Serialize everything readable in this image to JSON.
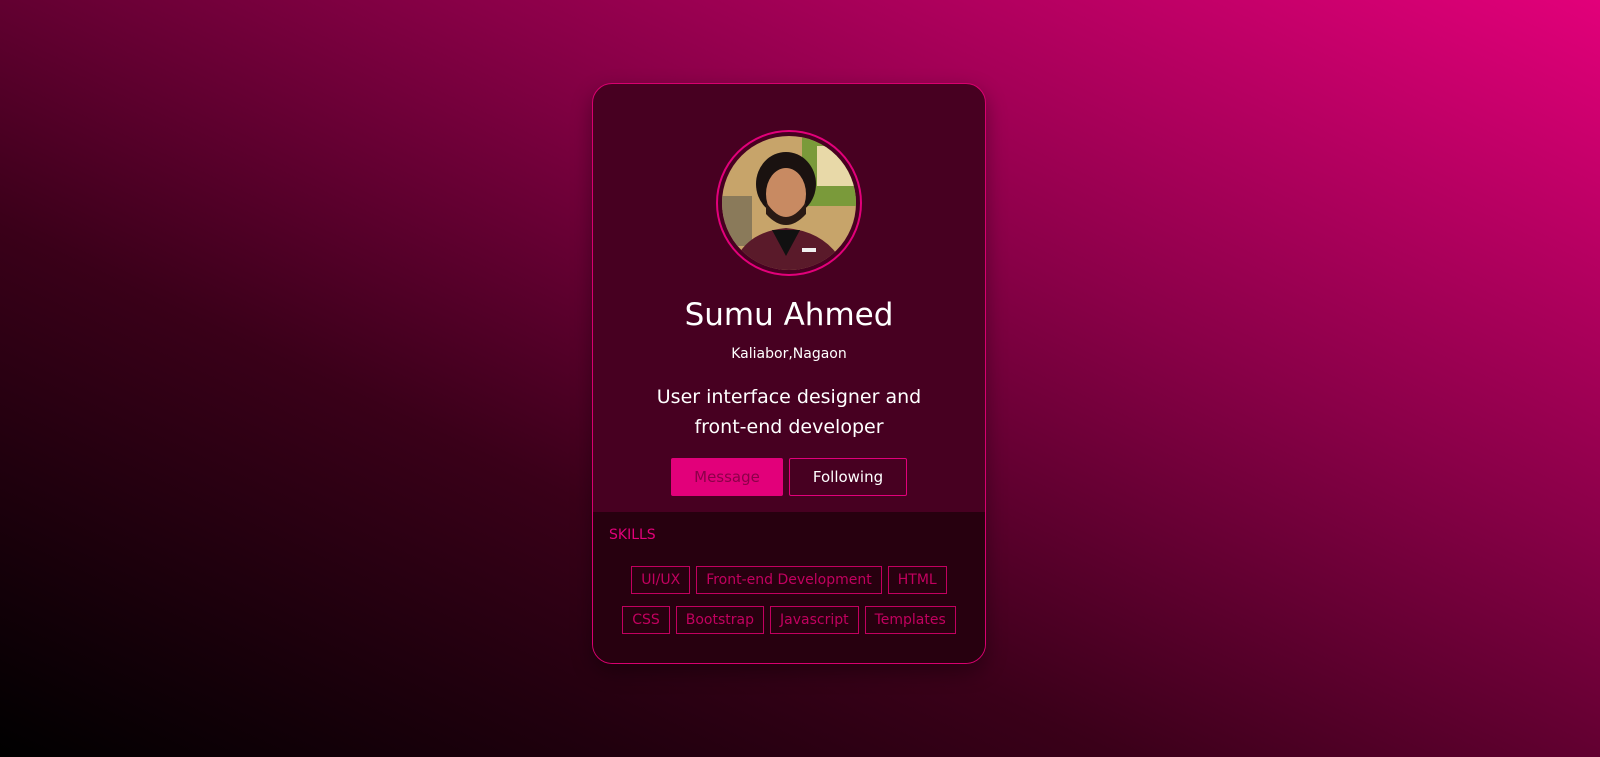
{
  "profile": {
    "name": "Sumu Ahmed",
    "location": "Kaliabor,Nagaon",
    "bio": "User interface designer and front-end developer",
    "avatar_icon": "profile-photo"
  },
  "actions": {
    "message_label": "Message",
    "following_label": "Following"
  },
  "skills": {
    "title": "SKILLS",
    "items": [
      "UI/UX",
      "Front-end Development",
      "HTML",
      "CSS",
      "Bootstrap",
      "Javascript",
      "Templates"
    ]
  },
  "colors": {
    "accent": "#e2007a",
    "card_background": "#470021",
    "skills_background": "#27000f"
  }
}
